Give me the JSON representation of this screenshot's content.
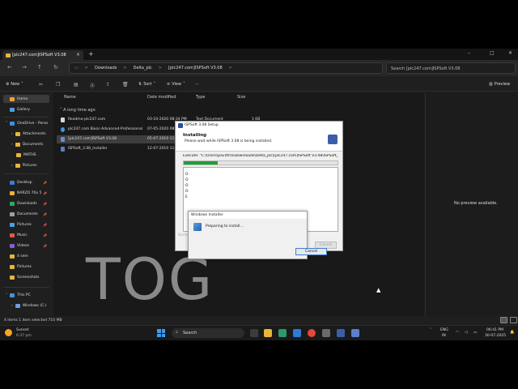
{
  "tab": {
    "title": "[plc247.com]ISPSoft V3.08",
    "close": "×",
    "add": "+"
  },
  "window": {
    "minimize": "–",
    "maximize": "□",
    "close": "✕"
  },
  "nav": {
    "back": "←",
    "forward": "→",
    "up": "↑",
    "refresh": "↻"
  },
  "breadcrumbs": [
    "Downloads",
    "Delta_plc",
    "[plc247.com]ISPSoft V3.08"
  ],
  "breadcrumb_sep": ">",
  "search": {
    "placeholder": "Search [plc247.com]ISPSoft V3.08"
  },
  "commands": {
    "new": "New",
    "sort": "Sort",
    "view": "View",
    "more": "···",
    "preview": "Preview"
  },
  "sidebar": {
    "items": [
      {
        "label": "Home",
        "color": "#e8a33a"
      },
      {
        "label": "Gallery",
        "color": "#4aa0e6"
      },
      {
        "label": "OneDrive - Perso",
        "color": "#3b8de0"
      },
      {
        "label": "Attachments",
        "color": "#e8b43a"
      },
      {
        "label": "Documents",
        "color": "#e8b43a"
      },
      {
        "label": "MATHS",
        "color": "#e8b43a"
      },
      {
        "label": "Pictures",
        "color": "#e8b43a"
      },
      {
        "label": "Desktop",
        "color": "#3a7bd5"
      },
      {
        "label": "NARZO 70x 5",
        "color": "#e8b43a"
      },
      {
        "label": "Downloads",
        "color": "#2fa860"
      },
      {
        "label": "Documents",
        "color": "#9aa0a6"
      },
      {
        "label": "Pictures",
        "color": "#4aa0e6"
      },
      {
        "label": "Music",
        "color": "#e05a4a"
      },
      {
        "label": "Videos",
        "color": "#8a5ad6"
      },
      {
        "label": "4 sem",
        "color": "#e8b43a"
      },
      {
        "label": "Pictures",
        "color": "#e8b43a"
      },
      {
        "label": "Screenshots",
        "color": "#e8b43a"
      },
      {
        "label": "This PC",
        "color": "#4a90d9"
      },
      {
        "label": "Windows (C:)",
        "color": "#6aa0e0"
      }
    ]
  },
  "columns": {
    "name": "Name",
    "date": "Date modified",
    "type": "Type",
    "size": "Size"
  },
  "group_label": "A long time ago",
  "files": [
    {
      "name": "Readme-plc247.com",
      "date": "03-10-2020 08:34 PM",
      "type": "Text Document",
      "size": "1 KB"
    },
    {
      "name": "plc247.com Basic-Advanced-Professional",
      "date": "07-05-2020 08:..",
      "type": "",
      "size": ""
    },
    {
      "name": "[plc247.com]ISPSoft V3.08",
      "date": "05-07-2019 11:..",
      "type": "",
      "size": ""
    },
    {
      "name": "ISPSoft_3.08_Installer",
      "date": "12-07-2019 11:..",
      "type": "",
      "size": ""
    }
  ],
  "preview_text": "No preview available.",
  "status": "4 items   1 item selected  710 MB",
  "watermark": "TOG",
  "setup": {
    "title": "ISPSoft 3.08 Setup",
    "heading": "Installing",
    "subheading": "Please wait while ISPSoft 3.08 is being installed.",
    "execute": "Execute: \"C:\\Users\\pavithra\\Downloads\\Delta_plc\\[plc247.com]ISPSoft V3.08\\ISPSoft_3.08_I",
    "progress": 0.22,
    "log": [
      "O",
      "O",
      "O",
      "O",
      "E"
    ],
    "nullsoft": "Nullsoft Install System v2.46.5-Unicode",
    "back": "< Back",
    "close": "Close",
    "cancel": "Cancel"
  },
  "installer": {
    "title": "Windows Installer",
    "message": "Preparing to install...",
    "cancel": "Cancel"
  },
  "taskbar": {
    "weather_title": "Sunset",
    "weather_time": "6:37 pm",
    "search": "Search",
    "lang_1": "ENG",
    "lang_2": "IN",
    "time": "06:41 PM",
    "date": "30-07-2025"
  }
}
